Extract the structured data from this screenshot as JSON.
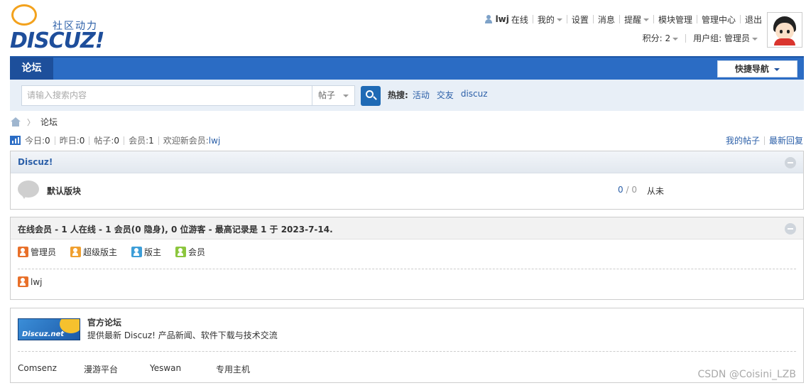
{
  "logo": {
    "tagline": "社区动力",
    "wordmark": "DISCUZ!"
  },
  "topnav": {
    "username": "lwj",
    "online": "在线",
    "items": [
      "我的",
      "设置",
      "消息",
      "提醒",
      "模块管理",
      "管理中心",
      "退出"
    ]
  },
  "subnav": {
    "points_label": "积分: 2",
    "group_label": "用户组: 管理员"
  },
  "navbar": {
    "tab": "论坛",
    "quick_nav": "快捷导航"
  },
  "search": {
    "placeholder": "请输入搜索内容",
    "type": "帖子",
    "hot_label": "热搜:",
    "hot_terms": [
      "活动",
      "交友",
      "discuz"
    ]
  },
  "breadcrumb": {
    "current": "论坛"
  },
  "stats": {
    "today_label": "今日:",
    "today": "0",
    "yesterday_label": "昨日:",
    "yesterday": "0",
    "posts_label": "帖子:",
    "posts": "0",
    "members_label": "会员:",
    "members": "1",
    "welcome_label": "欢迎新会员:",
    "welcome_user": "lwj",
    "links": [
      "我的帖子",
      "最新回复"
    ]
  },
  "category": {
    "title": "Discuz!",
    "forum": {
      "name": "默认版块",
      "threads": "0",
      "posts": "0",
      "last": "从未"
    }
  },
  "online": {
    "title": "在线会员 - 1 人在线 - 1 会员(0 隐身), 0 位游客 - 最高记录是 1 于 2023-7-14.",
    "legend": [
      {
        "label": "管理员",
        "color": "#e8702a"
      },
      {
        "label": "超级版主",
        "color": "#f0a030"
      },
      {
        "label": "版主",
        "color": "#3d9ed8"
      },
      {
        "label": "会员",
        "color": "#8cc63e"
      }
    ],
    "users": [
      "lwj"
    ]
  },
  "links": {
    "logo_text": "Discuz.net",
    "title": "官方论坛",
    "desc": "提供最新 Discuz! 产品新闻、软件下载与技术交流",
    "friends": [
      "Comsenz",
      "漫游平台",
      "Yeswan",
      "专用主机"
    ]
  },
  "watermark": "CSDN @Coisini_LZB"
}
